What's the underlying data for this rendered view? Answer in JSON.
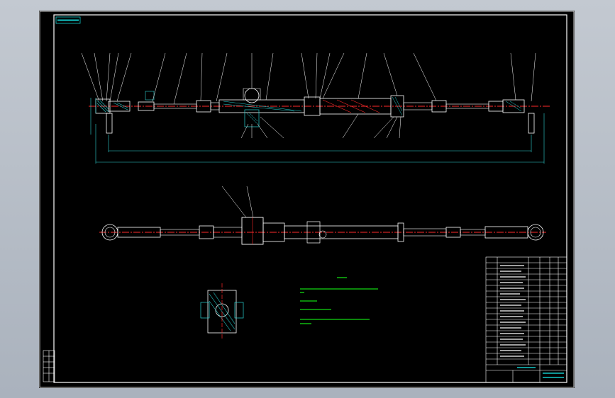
{
  "drawing": {
    "title_tab": "",
    "tech_notes_title": "",
    "tech_notes": [
      "",
      "",
      "",
      ""
    ],
    "colors": {
      "viewport_bg": "#000000",
      "frame": "#ffffff",
      "part_outline": "#ffffff",
      "centerline": "#ff2a2a",
      "hatch": "#27d3d3",
      "dimension": "#2fd3d3",
      "leader": "#ffffff",
      "note_text": "#12d812",
      "title_green": "#12c8c8"
    },
    "icons": {
      "front_view": "steering-gear-front-view-icon",
      "top_view": "steering-gear-top-view-icon",
      "section_view": "pinion-section-view-icon",
      "title_block": "title-block-table-icon"
    }
  }
}
